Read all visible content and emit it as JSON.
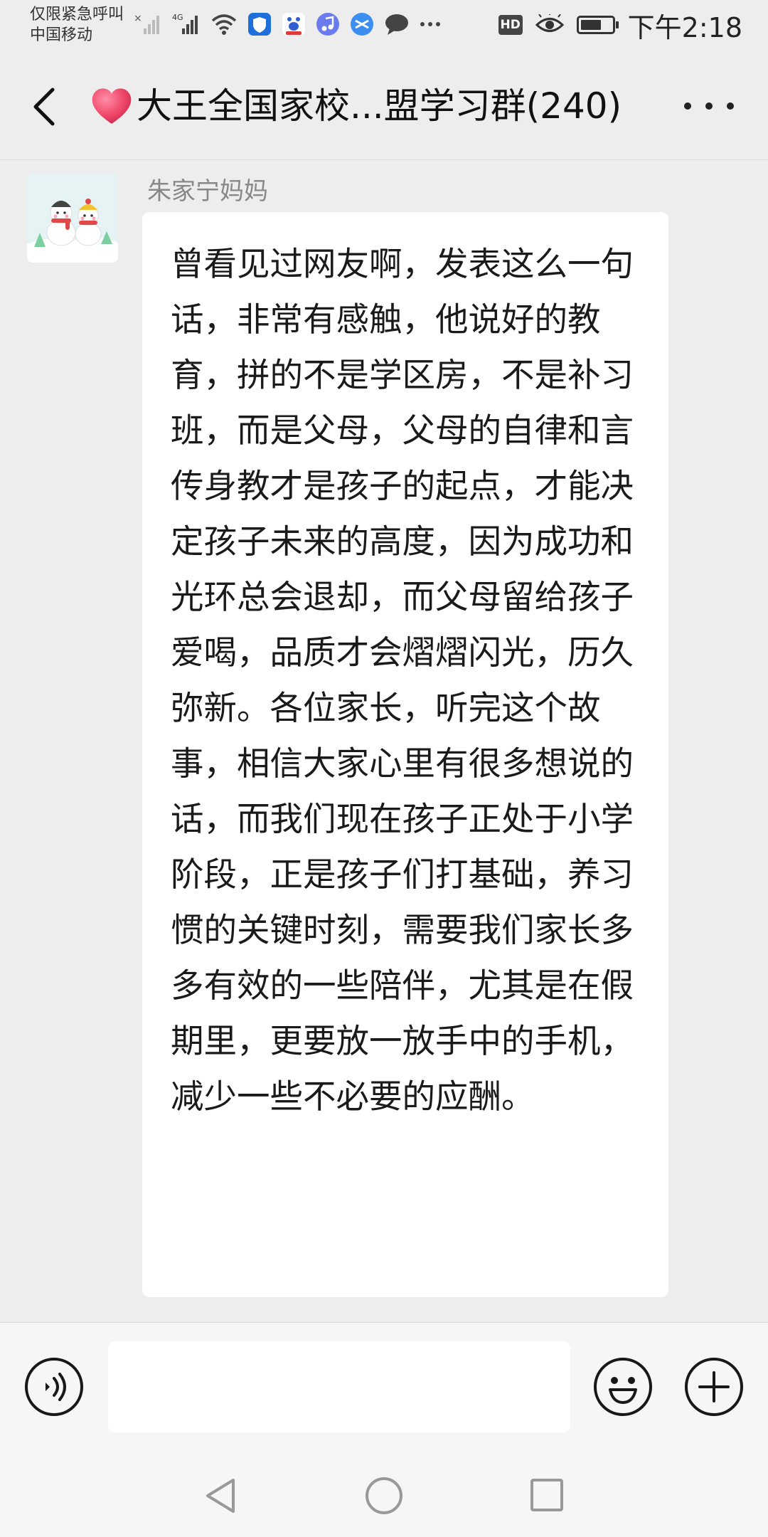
{
  "status_bar": {
    "carrier_line1": "仅限紧急呼叫",
    "carrier_line2": "中国移动",
    "hd_label": "HD",
    "time": "下午2:18"
  },
  "header": {
    "title": "大王全国家校...盟学习群(240)",
    "title_emoji": "heart-icon"
  },
  "message": {
    "sender": "朱家宁妈妈",
    "text": "曾看见过网友啊，发表这么一句话，非常有感触，他说好的教育，拼的不是学区房，不是补习班，而是父母，父母的自律和言传身教才是孩子的起点，才能决定孩子未来的高度，因为成功和光环总会退却，而父母留给孩子爱喝，品质才会熠熠闪光，历久弥新。各位家长，听完这个故事，相信大家心里有很多想说的话，而我们现在孩子正处于小学阶段，正是孩子们打基础，养习惯的关键时刻，需要我们家长多多有效的一些陪伴，尤其是在假期里，更要放一放手中的手机，减少一些不必要的应酬。"
  },
  "input": {
    "value": "",
    "placeholder": ""
  },
  "colors": {
    "background": "#ededed",
    "bubble": "#ffffff",
    "heart": "#f04a6c"
  }
}
